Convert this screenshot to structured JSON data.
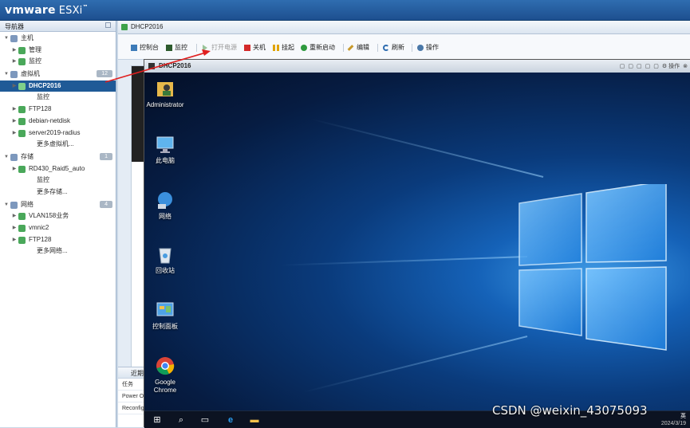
{
  "header": {
    "brand": "vmware",
    "product": "ESXi",
    "brand_suffix": "™"
  },
  "navigator": {
    "title": "导航器",
    "items": [
      {
        "label": "主机",
        "indent": 0,
        "section": true
      },
      {
        "label": "管理",
        "indent": 1
      },
      {
        "label": "监控",
        "indent": 1
      },
      {
        "label": "虚拟机",
        "indent": 0,
        "section": true,
        "badge": "12"
      },
      {
        "label": "DHCP2016",
        "indent": 1,
        "selected": true
      },
      {
        "label": "监控",
        "indent": 2
      },
      {
        "label": "FTP128",
        "indent": 1
      },
      {
        "label": "debian-netdisk",
        "indent": 1
      },
      {
        "label": "server2019-radius",
        "indent": 1
      },
      {
        "label": "更多虚拟机...",
        "indent": 2
      },
      {
        "label": "存储",
        "indent": 0,
        "section": true,
        "badge": "1"
      },
      {
        "label": "RD430_Raid5_auto",
        "indent": 1
      },
      {
        "label": "监控",
        "indent": 2
      },
      {
        "label": "更多存储...",
        "indent": 2
      },
      {
        "label": "网络",
        "indent": 0,
        "section": true,
        "badge": "4"
      },
      {
        "label": "VLAN158业务",
        "indent": 1
      },
      {
        "label": "vmnic2",
        "indent": 1
      },
      {
        "label": "FTP128",
        "indent": 1
      },
      {
        "label": "更多网络...",
        "indent": 2
      }
    ]
  },
  "vm_tab": {
    "title": "DHCP2016"
  },
  "toolbar": {
    "console": "控制台",
    "monitor": "监控",
    "power_on": "打开电源",
    "shutdown": "关机",
    "suspend": "挂起",
    "restart": "重新启动",
    "edit": "编辑",
    "refresh": "刷新",
    "actions": "操作"
  },
  "recent_tasks": {
    "title": "近期",
    "col_task": "任务",
    "rows": [
      "Power On",
      "Reconfig"
    ]
  },
  "console": {
    "title": "DHCP2016",
    "controls": [
      "▢",
      "▢",
      "▢",
      "▢",
      "▢",
      "⚙ 操作",
      "⊗"
    ],
    "desktop_icons": [
      {
        "label": "Administrator",
        "icon": "user-folder-icon"
      },
      {
        "label": "此电脑",
        "icon": "computer-icon"
      },
      {
        "label": "网络",
        "icon": "network-icon"
      },
      {
        "label": "回收站",
        "icon": "recycle-bin-icon"
      },
      {
        "label": "控制面板",
        "icon": "control-panel-icon"
      },
      {
        "label": "Google Chrome",
        "icon": "chrome-icon"
      }
    ],
    "tray": {
      "ime": "英",
      "time": "",
      "date": "2024/3/19"
    }
  },
  "watermark": "CSDN @weixin_43075093",
  "colors": {
    "header": "#2f6db0",
    "selected": "#1f5a97",
    "arrow": "#e02020",
    "desktop": "#0a3b7c"
  }
}
